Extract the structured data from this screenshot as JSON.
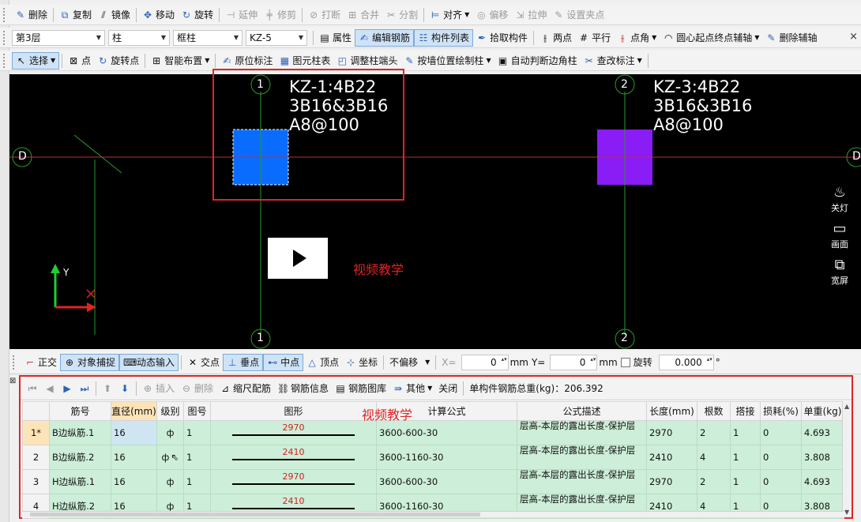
{
  "toolbar1": {
    "items": [
      {
        "label": "删除",
        "icon": "delete-icon",
        "disabled": false
      },
      {
        "label": "复制",
        "icon": "copy-icon",
        "disabled": false
      },
      {
        "label": "镜像",
        "icon": "mirror-icon",
        "disabled": false
      },
      {
        "label": "移动",
        "icon": "move-icon",
        "disabled": false
      },
      {
        "label": "旋转",
        "icon": "rotate-icon",
        "disabled": false
      },
      {
        "label": "延伸",
        "icon": "extend-icon",
        "disabled": true
      },
      {
        "label": "修剪",
        "icon": "trim-icon",
        "disabled": true
      },
      {
        "label": "打断",
        "icon": "break-icon",
        "disabled": true
      },
      {
        "label": "合并",
        "icon": "merge-icon",
        "disabled": true
      },
      {
        "label": "分割",
        "icon": "split-icon",
        "disabled": true
      },
      {
        "label": "对齐",
        "icon": "align-icon",
        "disabled": false
      },
      {
        "label": "偏移",
        "icon": "offset-icon",
        "disabled": true
      },
      {
        "label": "拉伸",
        "icon": "stretch-icon",
        "disabled": true
      },
      {
        "label": "设置夹点",
        "icon": "grip-point-icon",
        "disabled": true
      }
    ]
  },
  "toolbar2": {
    "floor": "第3层",
    "category": "柱",
    "type": "框柱",
    "component": "KZ-5",
    "properties": "属性",
    "edit_rebar": "编辑钢筋",
    "component_list": "构件列表",
    "pick_component": "拾取构件",
    "two_points": "两点",
    "parallel": "平行",
    "point_angle": "点角",
    "arc_axis": "圆心起点终点辅轴",
    "delete_axis": "删除辅轴"
  },
  "toolbar3": {
    "select": "选择",
    "point": "点",
    "rotate_point": "旋转点",
    "smart_layout": "智能布置",
    "original_annotation": "原位标注",
    "column_table": "图元柱表",
    "adjust_column_end": "调整柱端头",
    "draw_by_wall": "按墙位置绘制柱",
    "auto_corner": "自动判断边角柱",
    "check_annotation": "查改标注"
  },
  "canvas": {
    "axis_top_1": "1",
    "axis_top_2": "2",
    "axis_bottom_1": "1",
    "axis_bottom_2": "2",
    "axis_left_d": "D",
    "axis_right_d": "D",
    "column1_label": "KZ-1:4B22\n3B16&3B16\nA8@100",
    "column2_label": "KZ-3:4B22\n3B16&3B16\nA8@100",
    "video_label": "视频教学",
    "y_label": "Y",
    "column1_color": "#0a6cff",
    "column2_color": "#8a1cf5",
    "side_lamp": "关灯",
    "side_screen": "画面",
    "side_wide": "宽屏"
  },
  "snapbar": {
    "ortho": "正交",
    "object_snap": "对象捕捉",
    "dynamic_input": "动态输入",
    "intersection": "交点",
    "perpendicular": "垂点",
    "midpoint": "中点",
    "vertex": "顶点",
    "coordinate": "坐标",
    "no_offset": "不偏移",
    "x_label": "X=",
    "x_value": "0",
    "x_unit": "mm",
    "y_label": "Y=",
    "y_value": "0",
    "y_unit": "mm",
    "rotate_label": "旋转",
    "rotate_value": "0.000",
    "degree": "°"
  },
  "rebar_panel": {
    "insert": "插入",
    "delete": "删除",
    "scale_rebar": "缩尺配筋",
    "rebar_info": "钢筋信息",
    "rebar_library": "钢筋图库",
    "other": "其他",
    "close": "关闭",
    "total_weight": "单构件钢筋总重(kg)：206.392",
    "video_label": "视频教学",
    "headers": [
      "",
      "筋号",
      "直径(mm)",
      "级别",
      "图号",
      "图形",
      "计算公式",
      "公式描述",
      "长度(mm)",
      "根数",
      "搭接",
      "损耗(%)",
      "单重(kg)"
    ],
    "rows": [
      {
        "num": "1*",
        "name": "B边纵筋.1",
        "diameter": "16",
        "grade": "ф",
        "fig": "1",
        "shape_value": "2970",
        "formula": "3600-600-30",
        "desc": "层高-本层的露出长度-保护层",
        "length": "2970",
        "count": "2",
        "lap": "1",
        "loss": "0",
        "unit_weight": "4.693"
      },
      {
        "num": "2",
        "name": "B边纵筋.2",
        "diameter": "16",
        "grade": "ф",
        "fig": "1",
        "shape_value": "2410",
        "formula": "3600-1160-30",
        "desc": "层高-本层的露出长度-保护层",
        "length": "2410",
        "count": "4",
        "lap": "1",
        "loss": "0",
        "unit_weight": "3.808"
      },
      {
        "num": "3",
        "name": "H边纵筋.1",
        "diameter": "16",
        "grade": "ф",
        "fig": "1",
        "shape_value": "2970",
        "formula": "3600-600-30",
        "desc": "层高-本层的露出长度-保护层",
        "length": "2970",
        "count": "2",
        "lap": "1",
        "loss": "0",
        "unit_weight": "4.693"
      },
      {
        "num": "4",
        "name": "H边纵筋.2",
        "diameter": "16",
        "grade": "ф",
        "fig": "1",
        "shape_value": "2410",
        "formula": "3600-1160-30",
        "desc": "层高-本层的露出长度-保护层",
        "length": "2410",
        "count": "4",
        "lap": "1",
        "loss": "0",
        "unit_weight": "3.808"
      }
    ]
  }
}
